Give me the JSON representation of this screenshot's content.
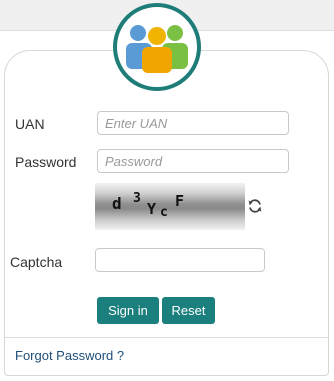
{
  "login_form": {
    "uan_label": "UAN",
    "uan_placeholder": "Enter UAN",
    "uan_value": "",
    "password_label": "Password",
    "password_placeholder": "Password",
    "password_value": "",
    "captcha_text": "d 3YcF",
    "captcha_label": "Captcha",
    "captcha_value": "",
    "captcha_placeholder": "",
    "signin_label": "Sign in",
    "reset_label": "Reset",
    "forgot_label": "Forgot Password ?"
  },
  "icons": {
    "logo": "people-group-icon",
    "refresh": "refresh-icon"
  },
  "colors": {
    "accent": "#1a7f7d",
    "logo_ring": "#1e7d78",
    "link": "#1f4e79",
    "person_left": "#5b9bd5",
    "person_center": "#f0b400",
    "person_right": "#7ac143"
  }
}
